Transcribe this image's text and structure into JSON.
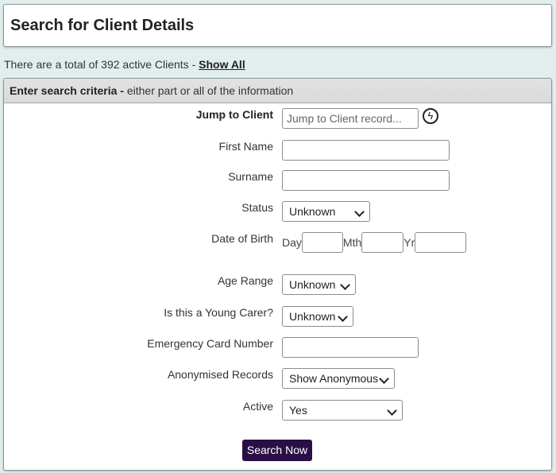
{
  "header": {
    "title": "Search for Client Details"
  },
  "summary": {
    "text": "There are a total of 392 active Clients - ",
    "link": "Show All"
  },
  "panel": {
    "heading_bold": "Enter search criteria -",
    "heading_rest": " either part or all of the information"
  },
  "form": {
    "jump": {
      "label": "Jump to Client",
      "placeholder": "Jump to Client record...",
      "icon": "lightning-icon"
    },
    "first_name": {
      "label": "First Name",
      "value": ""
    },
    "surname": {
      "label": "Surname",
      "value": ""
    },
    "status": {
      "label": "Status",
      "value": "Unknown"
    },
    "dob": {
      "label": "Date of Birth",
      "day_label": "Day",
      "month_label": "Mth",
      "year_label": "Yr"
    },
    "age_range": {
      "label": "Age Range",
      "value": "Unknown"
    },
    "young_carer": {
      "label": "Is this a Young Carer?",
      "value": "Unknown"
    },
    "emergency_card": {
      "label": "Emergency Card Number",
      "value": ""
    },
    "anonymised": {
      "label": "Anonymised Records",
      "value": "Show Anonymous"
    },
    "active": {
      "label": "Active",
      "value": "Yes"
    },
    "submit_label": "Search Now"
  },
  "colors": {
    "button_bg": "#2a0f45",
    "page_bg": "#e2eeee"
  }
}
